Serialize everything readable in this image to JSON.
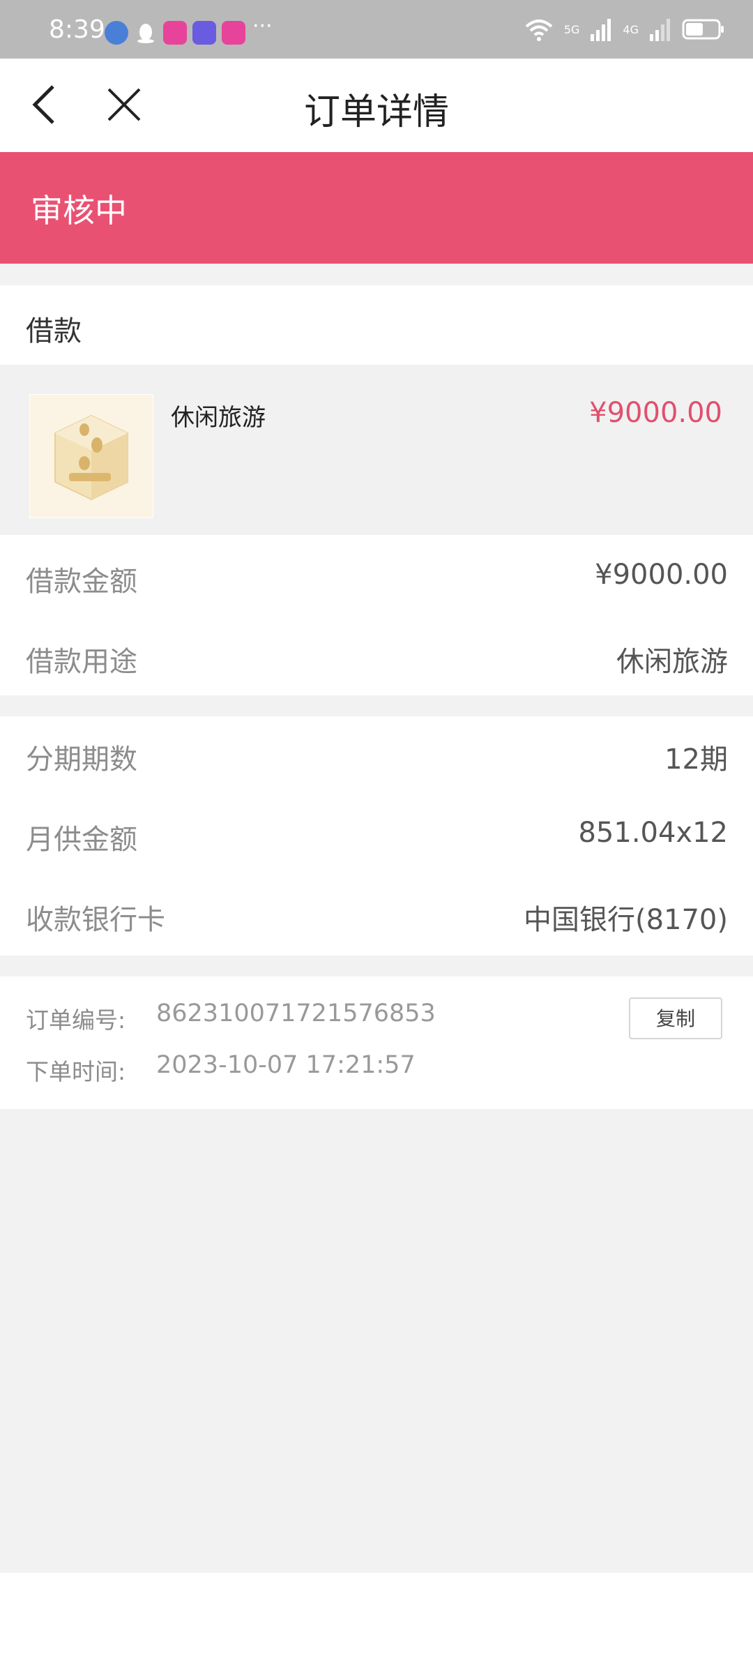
{
  "status_bar": {
    "time": "8:39",
    "more": "···",
    "network_1": "5G",
    "network_2": "4G",
    "wifi_label": "6",
    "battery_level": 0.55
  },
  "nav": {
    "title": "订单详情",
    "back_icon": "chevron-left-icon",
    "close_icon": "close-icon"
  },
  "banner": {
    "status": "审核中",
    "color": "#e95173"
  },
  "loan": {
    "section_title": "借款",
    "product_name": "休闲旅游",
    "product_price": "¥9000.00"
  },
  "details": [
    {
      "label": "借款金额",
      "value": "¥9000.00"
    },
    {
      "label": "借款用途",
      "value": "休闲旅游"
    }
  ],
  "installments": [
    {
      "label": "分期期数",
      "value": "12期"
    },
    {
      "label": "月供金额",
      "value": "851.04x12"
    },
    {
      "label": "收款银行卡",
      "value": "中国银行(8170)"
    }
  ],
  "order": {
    "number_label": "订单编号:",
    "number_value": "862310071721576853",
    "time_label": "下单时间:",
    "time_value": "2023-10-07 17:21:57",
    "copy_label": "复制"
  },
  "colors": {
    "accent": "#e0506e",
    "background": "#f2f2f2"
  }
}
